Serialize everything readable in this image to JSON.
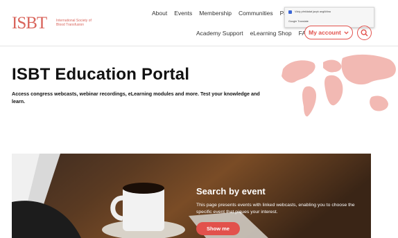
{
  "header": {
    "logo_mark": "ISBT",
    "logo_text": "International Society of Blood Transfusion",
    "nav_top": [
      "About",
      "Events",
      "Membership",
      "Communities",
      "Partne"
    ],
    "nav_top_clipped": "s",
    "nav_bottom": [
      "Academy Support",
      "eLearning Shop",
      "FAQ"
    ],
    "account_label": "My account",
    "translate_popup": {
      "option": "Vždy překládat jazyk angličtina",
      "brand": "Google Translate"
    }
  },
  "main": {
    "title": "ISBT Education Portal",
    "subtitle": "Access congress webcasts, webinar recordings, eLearning modules and more. Test your knowledge and learn."
  },
  "hero": {
    "title": "Search by event",
    "text": "This page presents events with linked webcasts, enabling you to choose the specific event that piques your interest.",
    "button_label": "Show me"
  },
  "colors": {
    "accent": "#e2514c",
    "logo": "#d9655c",
    "map": "#f2b9b3"
  },
  "icons": [
    "search-icon",
    "chevron-down-icon",
    "checkbox-icon",
    "world-map"
  ]
}
